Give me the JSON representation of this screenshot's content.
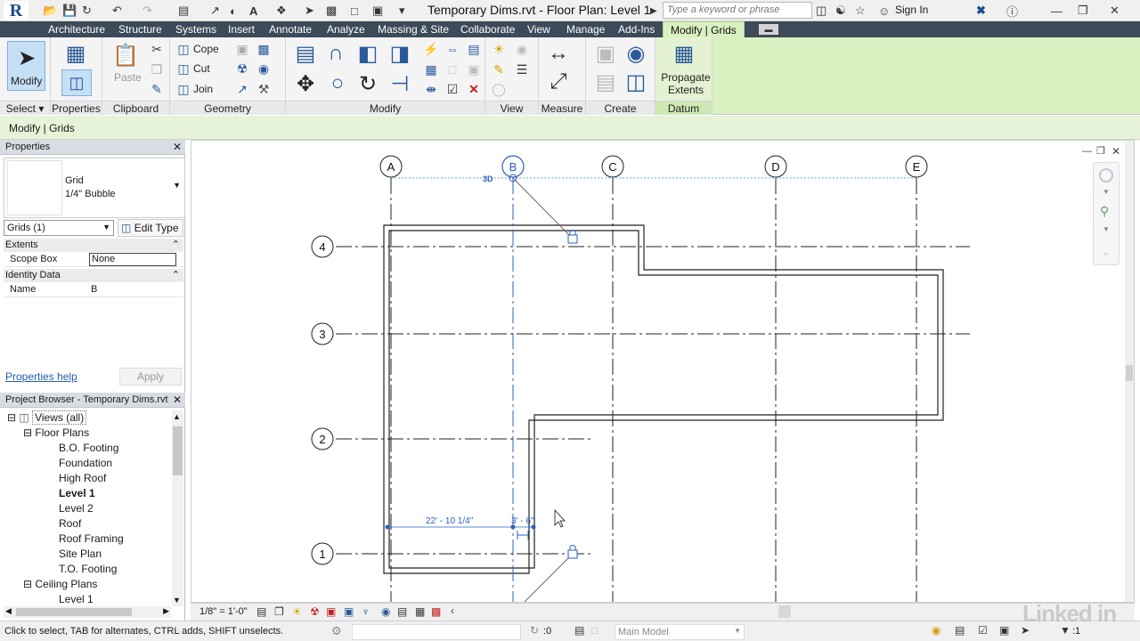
{
  "title_bar": {
    "document_title": "Temporary Dims.rvt - Floor Plan: Level 1",
    "search_placeholder": "Type a keyword or phrase",
    "sign_in": "Sign In",
    "app_logo": "R"
  },
  "tabs": [
    "Architecture",
    "Structure",
    "Systems",
    "Insert",
    "Annotate",
    "Analyze",
    "Massing & Site",
    "Collaborate",
    "View",
    "Manage",
    "Add-Ins",
    "Modify | Grids"
  ],
  "ribbon": {
    "modify_label": "Modify",
    "paste_label": "Paste",
    "cope_label": "Cope",
    "cut_label": "Cut",
    "join_label": "Join",
    "propagate_label": "Propagate Extents",
    "panels": {
      "select": "Select",
      "properties": "Properties",
      "clipboard": "Clipboard",
      "geometry": "Geometry",
      "modify": "Modify",
      "view": "View",
      "measure": "Measure",
      "create": "Create",
      "datum": "Datum"
    }
  },
  "context_bar": "Modify | Grids",
  "properties": {
    "header": "Properties",
    "type_name": "Grid",
    "type_sub": "1/4\" Bubble",
    "selector": "Grids (1)",
    "edit_type": "Edit Type",
    "extents_header": "Extents",
    "scope_box_label": "Scope Box",
    "scope_box_value": "None",
    "identity_header": "Identity Data",
    "name_label": "Name",
    "name_value": "B",
    "help_link": "Properties help",
    "apply": "Apply"
  },
  "browser": {
    "header": "Project Browser - Temporary Dims.rvt",
    "root": "Views (all)",
    "floor_plans": "Floor Plans",
    "floor_plan_items": [
      "B.O. Footing",
      "Foundation",
      "High Roof",
      "Level 1",
      "Level 2",
      "Roof",
      "Roof Framing",
      "Site Plan",
      "T.O. Footing"
    ],
    "active_item": "Level 1",
    "ceiling_plans": "Ceiling Plans",
    "ceiling_items": [
      "Level 1"
    ]
  },
  "drawing": {
    "grid_columns": [
      "A",
      "B",
      "C",
      "D",
      "E"
    ],
    "grid_rows": [
      "4",
      "3",
      "2",
      "1"
    ],
    "tag_3d": "3D",
    "dim_left": "22' - 10 1/4\"",
    "dim_right": "3' - 6\""
  },
  "view_bar": {
    "scale": "1/8\" = 1'-0\""
  },
  "status_bar": {
    "message": "Click to select, TAB for alternates, CTRL adds, SHIFT unselects.",
    "count": ":0",
    "model": "Main Model",
    "filter_count": ":1"
  },
  "watermark": "Linked in"
}
